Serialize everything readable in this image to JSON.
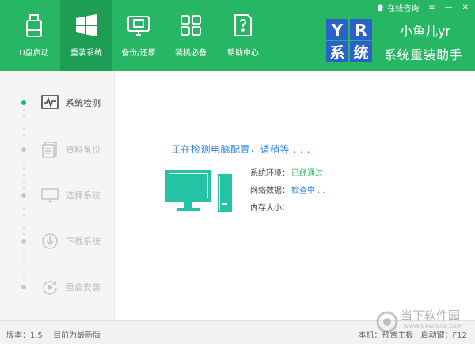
{
  "nav": {
    "items": [
      {
        "label": "U盘启动",
        "icon": "usb-drive-icon"
      },
      {
        "label": "重装系统",
        "icon": "windows-logo-icon"
      },
      {
        "label": "备份/还原",
        "icon": "backup-restore-icon"
      },
      {
        "label": "装机必备",
        "icon": "apps-grid-icon"
      },
      {
        "label": "帮助中心",
        "icon": "help-document-icon"
      }
    ],
    "active_index": 1
  },
  "window_controls": {
    "online_help": "在线咨询",
    "menu_glyph": "≡",
    "minimize_glyph": "—",
    "close_glyph": "✕"
  },
  "brand": {
    "name": "小鱼儿yr",
    "tagline": "系统重装助手"
  },
  "steps": [
    {
      "label": "系统检测",
      "icon": "monitor-pulse-icon",
      "active": true
    },
    {
      "label": "资料备份",
      "icon": "documents-icon",
      "active": false
    },
    {
      "label": "选择系统",
      "icon": "monitor-icon",
      "active": false
    },
    {
      "label": "下载系统",
      "icon": "download-icon",
      "active": false
    },
    {
      "label": "重启安装",
      "icon": "restart-icon",
      "active": false
    }
  ],
  "detect": {
    "title": "正在检测电脑配置，请稍等 . . .",
    "rows": [
      {
        "label": "系统环境：",
        "value": "已经通过",
        "state": "ok"
      },
      {
        "label": "网络数据：",
        "value": "检查中 . . .",
        "state": "busy"
      },
      {
        "label": "内存大小：",
        "value": "",
        "state": ""
      }
    ]
  },
  "status": {
    "version": "版本：1.5",
    "latest": "目前为最新版",
    "host": "本机：预置主板",
    "hotkey": "启动键：F12"
  },
  "watermark": {
    "text": "当下软件园",
    "url": "www.downxia.com"
  },
  "colors": {
    "primary_green": "#27b764",
    "active_tab": "#1e9e54",
    "link_blue": "#2c7fe0",
    "pc_teal": "#23c3a3"
  }
}
